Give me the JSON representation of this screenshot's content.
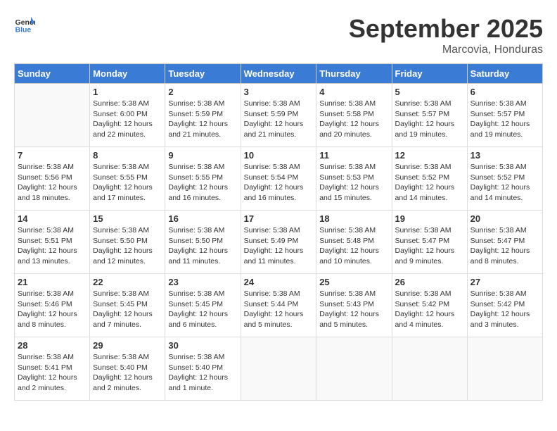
{
  "header": {
    "logo_general": "General",
    "logo_blue": "Blue",
    "month_title": "September 2025",
    "location": "Marcovia, Honduras"
  },
  "days_of_week": [
    "Sunday",
    "Monday",
    "Tuesday",
    "Wednesday",
    "Thursday",
    "Friday",
    "Saturday"
  ],
  "weeks": [
    [
      {
        "day": "",
        "info": ""
      },
      {
        "day": "1",
        "info": "Sunrise: 5:38 AM\nSunset: 6:00 PM\nDaylight: 12 hours\nand 22 minutes."
      },
      {
        "day": "2",
        "info": "Sunrise: 5:38 AM\nSunset: 5:59 PM\nDaylight: 12 hours\nand 21 minutes."
      },
      {
        "day": "3",
        "info": "Sunrise: 5:38 AM\nSunset: 5:59 PM\nDaylight: 12 hours\nand 21 minutes."
      },
      {
        "day": "4",
        "info": "Sunrise: 5:38 AM\nSunset: 5:58 PM\nDaylight: 12 hours\nand 20 minutes."
      },
      {
        "day": "5",
        "info": "Sunrise: 5:38 AM\nSunset: 5:57 PM\nDaylight: 12 hours\nand 19 minutes."
      },
      {
        "day": "6",
        "info": "Sunrise: 5:38 AM\nSunset: 5:57 PM\nDaylight: 12 hours\nand 19 minutes."
      }
    ],
    [
      {
        "day": "7",
        "info": "Sunrise: 5:38 AM\nSunset: 5:56 PM\nDaylight: 12 hours\nand 18 minutes."
      },
      {
        "day": "8",
        "info": "Sunrise: 5:38 AM\nSunset: 5:55 PM\nDaylight: 12 hours\nand 17 minutes."
      },
      {
        "day": "9",
        "info": "Sunrise: 5:38 AM\nSunset: 5:55 PM\nDaylight: 12 hours\nand 16 minutes."
      },
      {
        "day": "10",
        "info": "Sunrise: 5:38 AM\nSunset: 5:54 PM\nDaylight: 12 hours\nand 16 minutes."
      },
      {
        "day": "11",
        "info": "Sunrise: 5:38 AM\nSunset: 5:53 PM\nDaylight: 12 hours\nand 15 minutes."
      },
      {
        "day": "12",
        "info": "Sunrise: 5:38 AM\nSunset: 5:52 PM\nDaylight: 12 hours\nand 14 minutes."
      },
      {
        "day": "13",
        "info": "Sunrise: 5:38 AM\nSunset: 5:52 PM\nDaylight: 12 hours\nand 14 minutes."
      }
    ],
    [
      {
        "day": "14",
        "info": "Sunrise: 5:38 AM\nSunset: 5:51 PM\nDaylight: 12 hours\nand 13 minutes."
      },
      {
        "day": "15",
        "info": "Sunrise: 5:38 AM\nSunset: 5:50 PM\nDaylight: 12 hours\nand 12 minutes."
      },
      {
        "day": "16",
        "info": "Sunrise: 5:38 AM\nSunset: 5:50 PM\nDaylight: 12 hours\nand 11 minutes."
      },
      {
        "day": "17",
        "info": "Sunrise: 5:38 AM\nSunset: 5:49 PM\nDaylight: 12 hours\nand 11 minutes."
      },
      {
        "day": "18",
        "info": "Sunrise: 5:38 AM\nSunset: 5:48 PM\nDaylight: 12 hours\nand 10 minutes."
      },
      {
        "day": "19",
        "info": "Sunrise: 5:38 AM\nSunset: 5:47 PM\nDaylight: 12 hours\nand 9 minutes."
      },
      {
        "day": "20",
        "info": "Sunrise: 5:38 AM\nSunset: 5:47 PM\nDaylight: 12 hours\nand 8 minutes."
      }
    ],
    [
      {
        "day": "21",
        "info": "Sunrise: 5:38 AM\nSunset: 5:46 PM\nDaylight: 12 hours\nand 8 minutes."
      },
      {
        "day": "22",
        "info": "Sunrise: 5:38 AM\nSunset: 5:45 PM\nDaylight: 12 hours\nand 7 minutes."
      },
      {
        "day": "23",
        "info": "Sunrise: 5:38 AM\nSunset: 5:45 PM\nDaylight: 12 hours\nand 6 minutes."
      },
      {
        "day": "24",
        "info": "Sunrise: 5:38 AM\nSunset: 5:44 PM\nDaylight: 12 hours\nand 5 minutes."
      },
      {
        "day": "25",
        "info": "Sunrise: 5:38 AM\nSunset: 5:43 PM\nDaylight: 12 hours\nand 5 minutes."
      },
      {
        "day": "26",
        "info": "Sunrise: 5:38 AM\nSunset: 5:42 PM\nDaylight: 12 hours\nand 4 minutes."
      },
      {
        "day": "27",
        "info": "Sunrise: 5:38 AM\nSunset: 5:42 PM\nDaylight: 12 hours\nand 3 minutes."
      }
    ],
    [
      {
        "day": "28",
        "info": "Sunrise: 5:38 AM\nSunset: 5:41 PM\nDaylight: 12 hours\nand 2 minutes."
      },
      {
        "day": "29",
        "info": "Sunrise: 5:38 AM\nSunset: 5:40 PM\nDaylight: 12 hours\nand 2 minutes."
      },
      {
        "day": "30",
        "info": "Sunrise: 5:38 AM\nSunset: 5:40 PM\nDaylight: 12 hours\nand 1 minute."
      },
      {
        "day": "",
        "info": ""
      },
      {
        "day": "",
        "info": ""
      },
      {
        "day": "",
        "info": ""
      },
      {
        "day": "",
        "info": ""
      }
    ]
  ]
}
